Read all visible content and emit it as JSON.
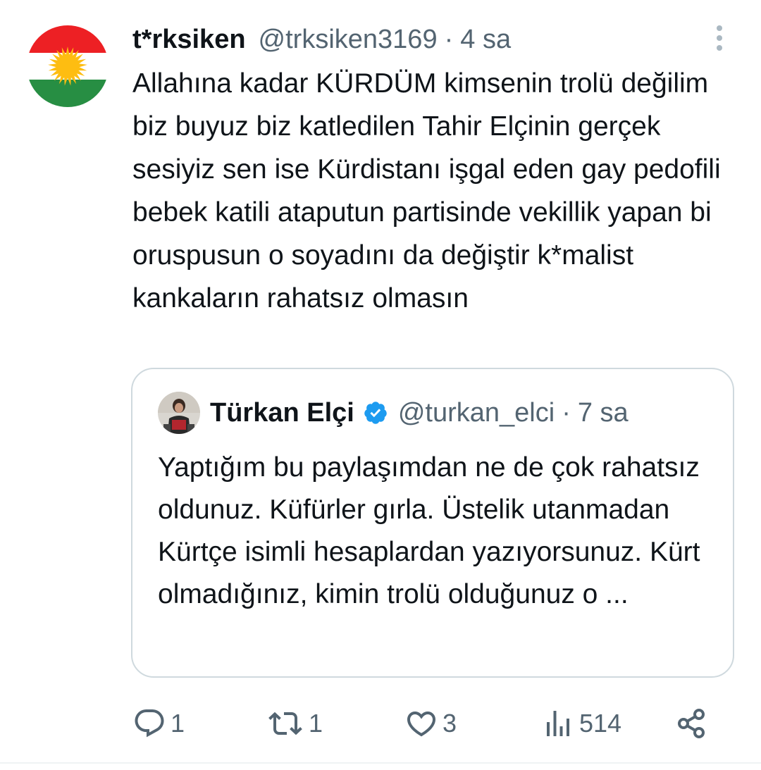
{
  "colors": {
    "text": "#0f1419",
    "secondary": "#536471",
    "border": "#cfd9de",
    "verified": "#1d9bf0",
    "flag_red": "#ed2024",
    "flag_green": "#278e43",
    "flag_sun": "#febd11"
  },
  "tweet": {
    "display_name": "t*rksiken",
    "handle": "@trksiken3169",
    "separator": "·",
    "time": "4 sa",
    "text": "Allahına kadar KÜRDÜM kimsenin trolü değilim biz buyuz biz katledilen Tahir Elçinin gerçek sesiyiz sen ise Kürdistanı işgal eden gay pedofili bebek katili ataputun partisinde vekillik yapan bi oruspusun o soyadını da değiştir k*malist kankaların rahatsız olmasın",
    "avatar_icon": "kurdistan-flag-icon",
    "more_icon": "more-vertical-icon"
  },
  "quote": {
    "display_name": "Türkan Elçi",
    "verified_icon": "verified-badge-icon",
    "handle": "@turkan_elci",
    "separator": "·",
    "time": "7 sa",
    "text": "Yaptığım bu paylaşımdan ne de çok rahatsız oldunuz. Küfürler gırla. Üstelik utanmadan Kürtçe isimli hesaplardan yazıyorsunuz. Kürt olmadığınız, kimin trolü olduğunuz o ..."
  },
  "actions": {
    "reply": {
      "icon": "reply-icon",
      "count": "1"
    },
    "retweet": {
      "icon": "retweet-icon",
      "count": "1"
    },
    "like": {
      "icon": "heart-icon",
      "count": "3"
    },
    "views": {
      "icon": "views-chart-icon",
      "count": "514"
    },
    "share": {
      "icon": "share-icon"
    }
  }
}
